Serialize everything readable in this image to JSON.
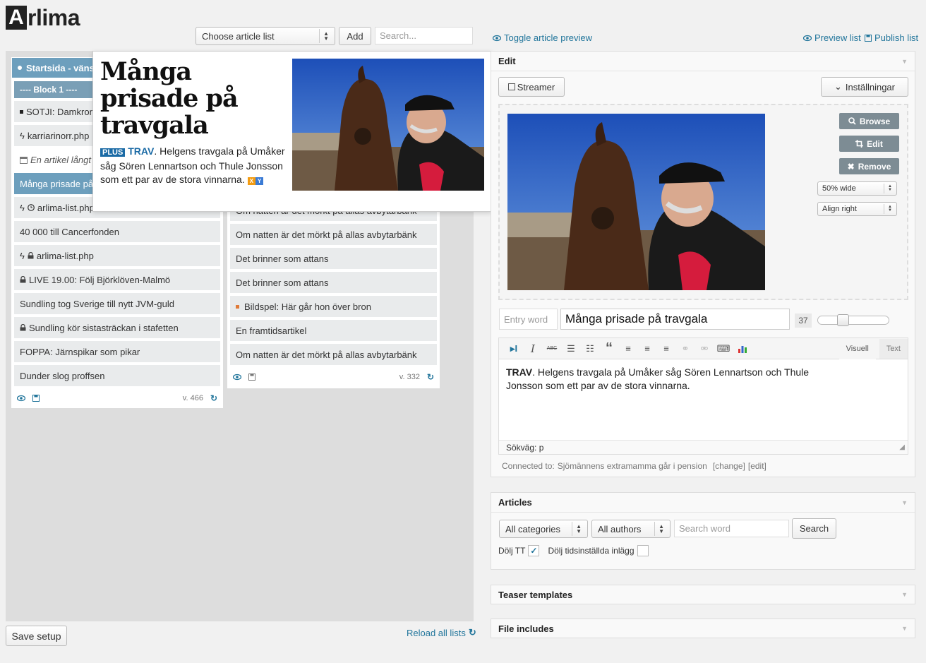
{
  "app": {
    "logo_letter": "A",
    "logo_rest": "rlima"
  },
  "toolbar": {
    "article_list_select": "Choose article list",
    "add_label": "Add",
    "search_placeholder": "Search...",
    "toggle_preview": "Toggle article preview",
    "preview_list": "Preview list",
    "publish_list": "Publish list"
  },
  "left_column": {
    "header": "Startsida - vänste",
    "block": "---- Block 1 ----",
    "items": [
      "SOTJI: Damkrono",
      "karriarinorr.php",
      "En artikel långt f",
      "Många prisade på",
      "arlima-list.php",
      "40 000 till Cancerfonden",
      "arlima-list.php",
      "LIVE 19.00: Följ Björklöven-Malmö",
      "Sundling tog Sverige till nytt JVM-guld",
      "Sundling kör sistasträckan i stafetten",
      "FOPPA: Järnspikar som pikar",
      "Dunder slog proffsen"
    ],
    "version": "v. 466"
  },
  "right_column": {
    "items": [
      "Om natten är det mörkt på allas avbytarbänk",
      "Om natten är det mörkt på allas avbytarbänk",
      "Det brinner som attans",
      "Det brinner som attans",
      "Bildspel: Här går hon över bron",
      "En framtidsartikel",
      "Om natten är det mörkt på allas avbytarbänk"
    ],
    "version": "v. 332"
  },
  "preview": {
    "headline": "Många prisade på travgala",
    "plus_badge": "PLUS",
    "kicker": "TRAV",
    "text": ". Helgens travgala på Umåker såg Sören Lennartson och Thule Jonsson som ett par av de stora vinnarna.",
    "tag_x": "X",
    "tag_y": "Y"
  },
  "edit_panel": {
    "title": "Edit",
    "streamer": "Streamer",
    "settings": "Inställningar",
    "browse": "Browse",
    "edit": "Edit",
    "remove": "Remove",
    "width_select": "50% wide",
    "align_select": "Align right",
    "entry_word_placeholder": "Entry word",
    "title_value": "Många prisade på travgala",
    "font_size": "37",
    "font_slider_fraction": 0.32,
    "tab_visual": "Visuell",
    "tab_text": "Text",
    "body_bold": "TRAV",
    "body_text": ". Helgens travgala på Umåker såg Sören Lennartson och Thule Jonsson som ett par av de stora vinnarna.",
    "path": "Sökväg: p",
    "connected_label": "Connected to:",
    "connected_to": "Sjömännens extramamma går i pension",
    "change": "[change]",
    "edit_link": "[edit]"
  },
  "articles_panel": {
    "title": "Articles",
    "categories": "All categories",
    "authors": "All authors",
    "search_placeholder": "Search word",
    "search_button": "Search",
    "hide_tt": "Dölj TT",
    "hide_scheduled": "Dölj tidsinställda inlägg"
  },
  "teaser_panel": {
    "title": "Teaser templates"
  },
  "file_panel": {
    "title": "File includes"
  },
  "footer": {
    "save_setup": "Save setup",
    "reload": "Reload all lists"
  },
  "colors": {
    "accent_blue": "#6d9fbd",
    "link": "#21759b",
    "button_grey": "#7d8c94",
    "plus_blue": "#1a6aa5"
  }
}
